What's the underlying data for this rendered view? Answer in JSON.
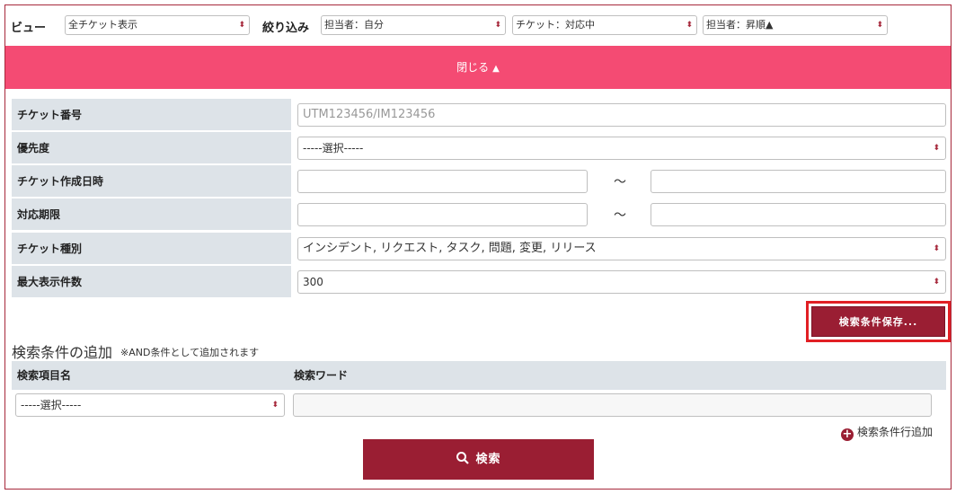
{
  "topbar": {
    "view_label": "ビュー",
    "view_value": "全チケット表示",
    "filter_label": "絞り込み",
    "filter_assignee": "担当者：自分",
    "filter_ticket": "チケット：対応中",
    "sort_value": "担当者：昇順▲"
  },
  "toggle": {
    "label": "閉じる",
    "icon": "▲"
  },
  "form": {
    "ticket_no": {
      "label": "チケット番号",
      "placeholder": "UTM123456/IM123456"
    },
    "priority": {
      "label": "優先度",
      "value": "-----選択-----"
    },
    "created": {
      "label": "チケット作成日時",
      "tilde": "～"
    },
    "due": {
      "label": "対応期限",
      "tilde": "～"
    },
    "type": {
      "label": "チケット種別",
      "value": "インシデント, リクエスト, タスク, 問題, 変更, リリース"
    },
    "max": {
      "label": "最大表示件数",
      "value": "300"
    }
  },
  "save_button": "検索条件保存...",
  "add_section": {
    "title": "検索条件の追加",
    "note": "※AND条件として追加されます",
    "col_item": "検索項目名",
    "col_word": "検索ワード",
    "item_select": "-----選択-----",
    "add_row": "検索条件行追加"
  },
  "search_button": "検索",
  "colors": {
    "accent": "#9a1e33",
    "pink": "#f44b73",
    "label_bg": "#dde3e8",
    "highlight": "#e11f24"
  }
}
